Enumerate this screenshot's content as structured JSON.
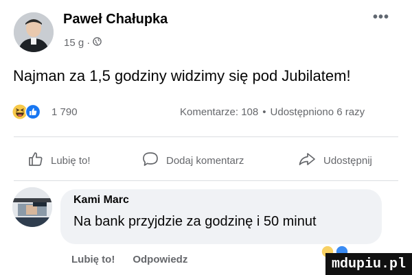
{
  "post": {
    "author": "Paweł Chałupka",
    "time": "15 g",
    "separator": "·",
    "text": "Najman za 1,5 godziny widzimy się pod Jubilatem!",
    "more_icon": "more-horizontal-icon",
    "audience_icon": "globe-icon"
  },
  "reactions": {
    "count": "1 790",
    "icons": [
      "laugh-emoji-icon",
      "like-reaction-icon"
    ]
  },
  "stats": {
    "comments": "Komentarze: 108",
    "dot": "•",
    "shares": "Udostępniono 6 razy"
  },
  "actions": {
    "like": "Lubię to!",
    "comment": "Dodaj komentarz",
    "share": "Udostępnij"
  },
  "comment": {
    "author": "Kami Marc",
    "text": "Na bank przyjdzie za godzinę i 50 minut",
    "like": "Lubię to!",
    "reply": "Odpowiedz"
  },
  "watermark": "mdupiu.pl",
  "colors": {
    "text_primary": "#050505",
    "text_secondary": "#65676b",
    "like_blue": "#1877f2",
    "bubble_bg": "#f0f2f5",
    "divider": "#dadde1"
  }
}
